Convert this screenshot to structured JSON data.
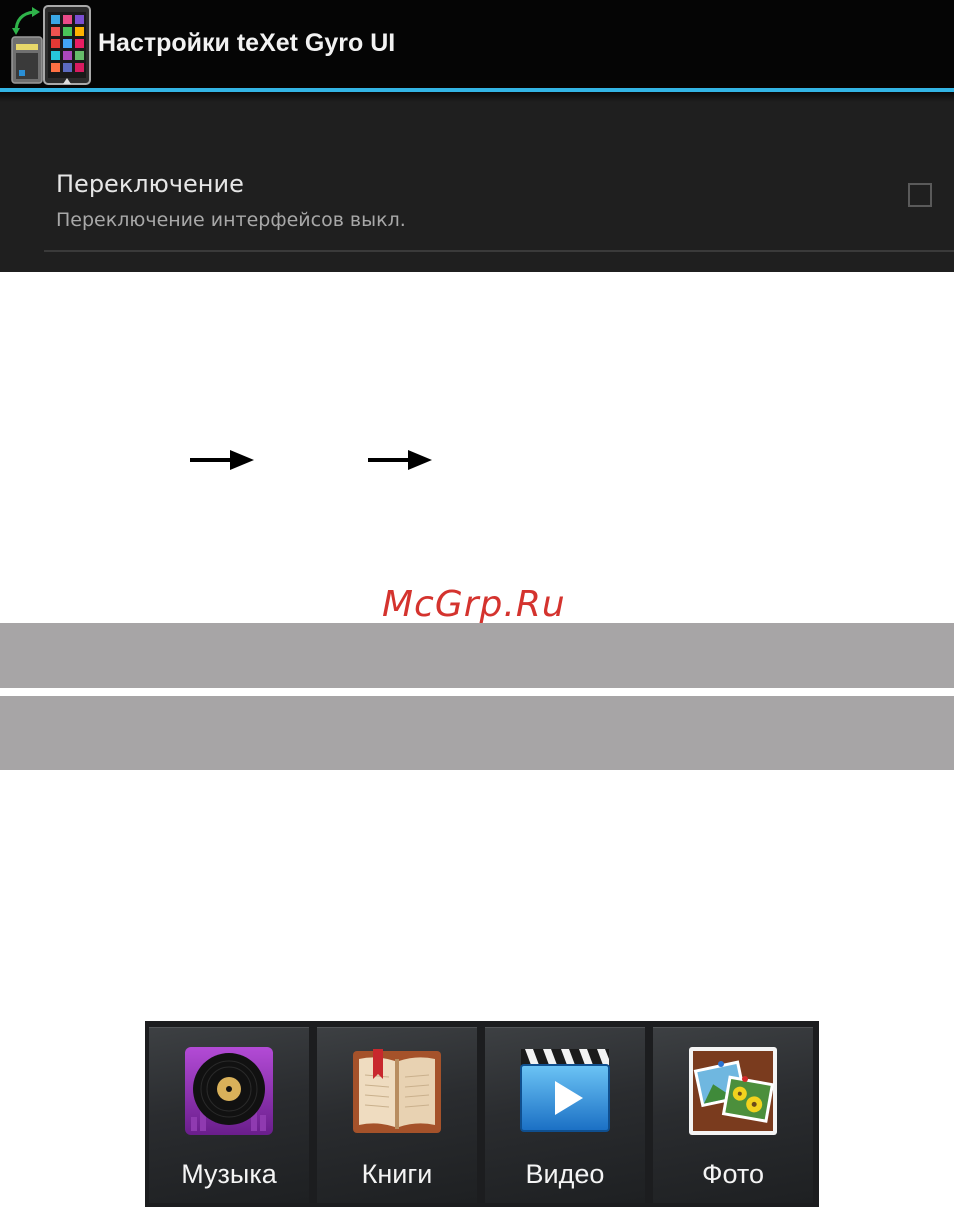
{
  "settings": {
    "title": "Настройки teXet Gyro UI",
    "accent_color": "#33b5e5",
    "preference": {
      "title": "Переключение",
      "summary": "Переключение интерфейсов выкл.",
      "checked": false
    }
  },
  "icons": {
    "app": "gyro-ui-app-icon",
    "arrow": "right-arrow-icon"
  },
  "watermark": "McGrp.Ru",
  "dock": {
    "items": [
      {
        "label": "Музыка",
        "icon": "music-vinyl-icon"
      },
      {
        "label": "Книги",
        "icon": "books-icon"
      },
      {
        "label": "Видео",
        "icon": "video-clapper-icon"
      },
      {
        "label": "Фото",
        "icon": "photo-gallery-icon"
      }
    ]
  },
  "colors": {
    "gray_bar": "#a7a5a6",
    "watermark": "#d4332e"
  }
}
